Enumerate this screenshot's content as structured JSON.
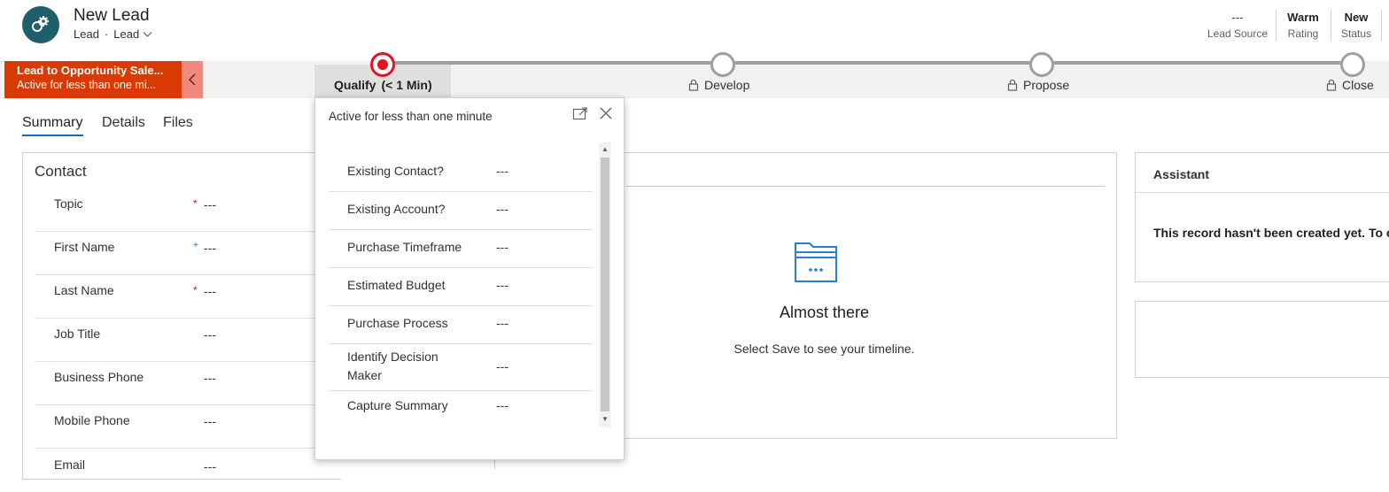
{
  "header": {
    "title": "New Lead",
    "entity": "Lead",
    "form": "Lead",
    "fields": [
      {
        "value": "---",
        "label": "Lead Source"
      },
      {
        "value": "Warm",
        "label": "Rating"
      },
      {
        "value": "New",
        "label": "Status"
      }
    ]
  },
  "bpf": {
    "name": "Lead to Opportunity Sale...",
    "duration": "Active for less than one mi...",
    "stages": [
      {
        "name": "Qualify",
        "duration": "(< 1 Min)",
        "active": true
      },
      {
        "name": "Develop",
        "locked": true
      },
      {
        "name": "Propose",
        "locked": true
      },
      {
        "name": "Close",
        "locked": true
      }
    ]
  },
  "tabs": [
    "Summary",
    "Details",
    "Files"
  ],
  "contact": {
    "title": "Contact",
    "fields": [
      {
        "label": "Topic",
        "req": "*",
        "value": "---"
      },
      {
        "label": "First Name",
        "req": "+",
        "value": "---"
      },
      {
        "label": "Last Name",
        "req": "*",
        "value": "---"
      },
      {
        "label": "Job Title",
        "req": "",
        "value": "---"
      },
      {
        "label": "Business Phone",
        "req": "",
        "value": "---"
      },
      {
        "label": "Mobile Phone",
        "req": "",
        "value": "---"
      },
      {
        "label": "Email",
        "req": "",
        "value": "---"
      }
    ]
  },
  "timeline": {
    "heading": "Almost there",
    "hint": "Select Save to see your timeline."
  },
  "assistant": {
    "title": "Assistant",
    "message": "This record hasn't been created yet. To ena"
  },
  "flyout": {
    "title": "Active for less than one minute",
    "steps": [
      {
        "label": "Existing Contact?",
        "value": "---"
      },
      {
        "label": "Existing Account?",
        "value": "---"
      },
      {
        "label": "Purchase Timeframe",
        "value": "---"
      },
      {
        "label": "Estimated Budget",
        "value": "---"
      },
      {
        "label": "Purchase Process",
        "value": "---"
      },
      {
        "label": "Identify Decision Maker",
        "value": "---"
      },
      {
        "label": "Capture Summary",
        "value": "---"
      }
    ]
  },
  "colors": {
    "bpf_flag": "#d83b01",
    "active_stage": "#e81123",
    "tab_accent": "#0f6cbd",
    "avatar": "#1f5e6b"
  }
}
